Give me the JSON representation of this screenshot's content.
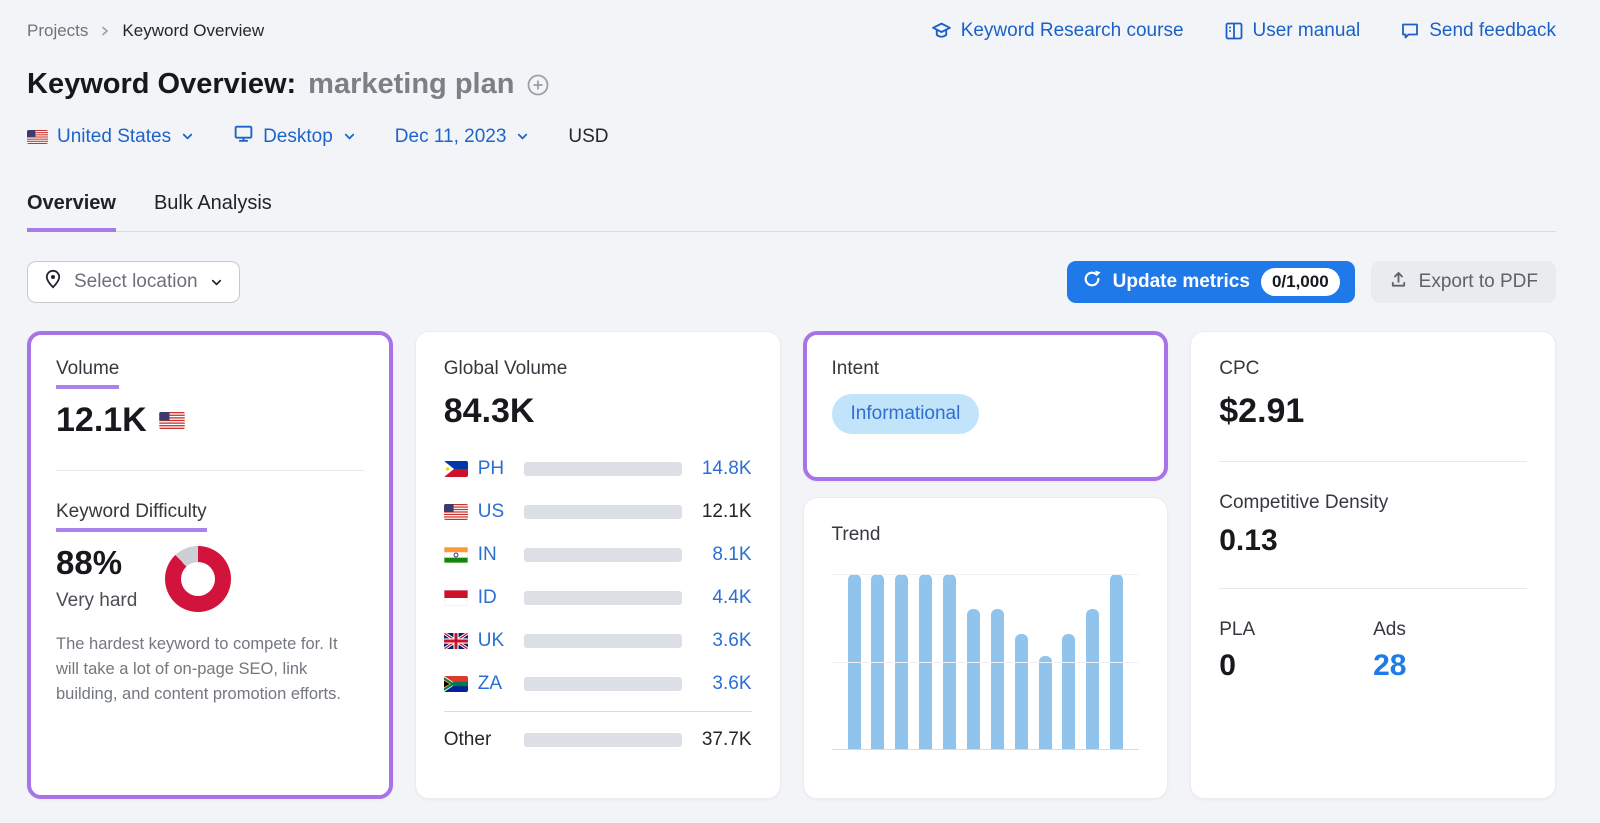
{
  "colors": {
    "accent_purple": "#a873e8",
    "link_blue": "#1e64c8",
    "button_blue": "#2079e8",
    "bar_light_blue": "#2caef5",
    "bar_us_blue": "#0d6bc7",
    "trend_bar_blue": "#90c4ec",
    "kd_red": "#d2143c",
    "intent_badge_bg": "#c1e4fb"
  },
  "breadcrumb": {
    "root": "Projects",
    "current": "Keyword Overview"
  },
  "header_links": [
    {
      "label": "Keyword Research course",
      "icon": "graduation-cap-icon"
    },
    {
      "label": "User manual",
      "icon": "book-icon"
    },
    {
      "label": "Send feedback",
      "icon": "feedback-bubble-icon"
    }
  ],
  "title": {
    "prefix": "Keyword Overview:",
    "keyword": "marketing plan"
  },
  "filters": {
    "location": "United States",
    "device": "Desktop",
    "date": "Dec 11, 2023",
    "currency": "USD"
  },
  "tabs": {
    "overview": "Overview",
    "bulk_analysis": "Bulk Analysis"
  },
  "toolbar": {
    "select_location": "Select location",
    "update_metrics": "Update metrics",
    "update_count": "0/1,000",
    "export_pdf": "Export to PDF"
  },
  "cards": {
    "volume": {
      "label": "Volume",
      "value": "12.1K",
      "kd_label": "Keyword Difficulty",
      "kd_value": "88%",
      "kd_percent": 88,
      "kd_level": "Very hard",
      "kd_description": "The hardest keyword to compete for. It will take a lot of on-page SEO, link building, and content promotion efforts."
    },
    "global_volume": {
      "label": "Global Volume",
      "value": "84.3K"
    },
    "intent": {
      "label": "Intent",
      "badge": "Informational"
    },
    "trend": {
      "label": "Trend"
    },
    "cpc": {
      "label": "CPC",
      "value": "$2.91",
      "cd_label": "Competitive Density",
      "cd_value": "0.13",
      "pla_label": "PLA",
      "pla_value": "0",
      "ads_label": "Ads",
      "ads_value": "28"
    }
  },
  "chart_data": [
    {
      "type": "bar",
      "name": "global-volume-by-country",
      "orientation": "horizontal",
      "title": "Global Volume",
      "total": 84300,
      "total_label": "84.3K",
      "categories": [
        "PH",
        "US",
        "IN",
        "ID",
        "UK",
        "ZA",
        "Other"
      ],
      "values": [
        14800,
        12100,
        8100,
        4400,
        3600,
        3600,
        37700
      ],
      "value_labels": [
        "14.8K",
        "12.1K",
        "8.1K",
        "4.4K",
        "3.6K",
        "3.6K",
        "37.7K"
      ]
    },
    {
      "type": "bar",
      "name": "trend",
      "title": "Trend",
      "values_pct_of_max": [
        100,
        100,
        100,
        100,
        100,
        80,
        80,
        66,
        53,
        66,
        80,
        100
      ],
      "gridlines_pct": [
        0,
        50,
        100
      ],
      "x_count": 12
    }
  ]
}
